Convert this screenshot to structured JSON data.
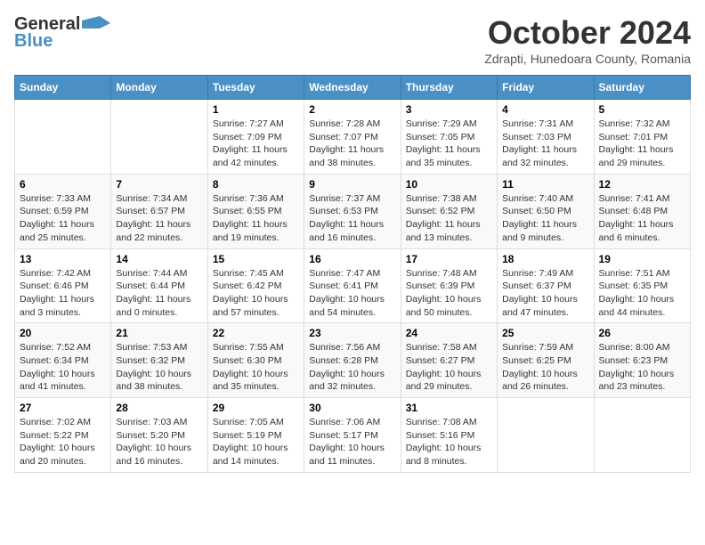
{
  "header": {
    "logo_general": "General",
    "logo_blue": "Blue",
    "month_title": "October 2024",
    "location": "Zdrapti, Hunedoara County, Romania"
  },
  "weekdays": [
    "Sunday",
    "Monday",
    "Tuesday",
    "Wednesday",
    "Thursday",
    "Friday",
    "Saturday"
  ],
  "weeks": [
    [
      {
        "day": "",
        "info": ""
      },
      {
        "day": "",
        "info": ""
      },
      {
        "day": "1",
        "info": "Sunrise: 7:27 AM\nSunset: 7:09 PM\nDaylight: 11 hours and 42 minutes."
      },
      {
        "day": "2",
        "info": "Sunrise: 7:28 AM\nSunset: 7:07 PM\nDaylight: 11 hours and 38 minutes."
      },
      {
        "day": "3",
        "info": "Sunrise: 7:29 AM\nSunset: 7:05 PM\nDaylight: 11 hours and 35 minutes."
      },
      {
        "day": "4",
        "info": "Sunrise: 7:31 AM\nSunset: 7:03 PM\nDaylight: 11 hours and 32 minutes."
      },
      {
        "day": "5",
        "info": "Sunrise: 7:32 AM\nSunset: 7:01 PM\nDaylight: 11 hours and 29 minutes."
      }
    ],
    [
      {
        "day": "6",
        "info": "Sunrise: 7:33 AM\nSunset: 6:59 PM\nDaylight: 11 hours and 25 minutes."
      },
      {
        "day": "7",
        "info": "Sunrise: 7:34 AM\nSunset: 6:57 PM\nDaylight: 11 hours and 22 minutes."
      },
      {
        "day": "8",
        "info": "Sunrise: 7:36 AM\nSunset: 6:55 PM\nDaylight: 11 hours and 19 minutes."
      },
      {
        "day": "9",
        "info": "Sunrise: 7:37 AM\nSunset: 6:53 PM\nDaylight: 11 hours and 16 minutes."
      },
      {
        "day": "10",
        "info": "Sunrise: 7:38 AM\nSunset: 6:52 PM\nDaylight: 11 hours and 13 minutes."
      },
      {
        "day": "11",
        "info": "Sunrise: 7:40 AM\nSunset: 6:50 PM\nDaylight: 11 hours and 9 minutes."
      },
      {
        "day": "12",
        "info": "Sunrise: 7:41 AM\nSunset: 6:48 PM\nDaylight: 11 hours and 6 minutes."
      }
    ],
    [
      {
        "day": "13",
        "info": "Sunrise: 7:42 AM\nSunset: 6:46 PM\nDaylight: 11 hours and 3 minutes."
      },
      {
        "day": "14",
        "info": "Sunrise: 7:44 AM\nSunset: 6:44 PM\nDaylight: 11 hours and 0 minutes."
      },
      {
        "day": "15",
        "info": "Sunrise: 7:45 AM\nSunset: 6:42 PM\nDaylight: 10 hours and 57 minutes."
      },
      {
        "day": "16",
        "info": "Sunrise: 7:47 AM\nSunset: 6:41 PM\nDaylight: 10 hours and 54 minutes."
      },
      {
        "day": "17",
        "info": "Sunrise: 7:48 AM\nSunset: 6:39 PM\nDaylight: 10 hours and 50 minutes."
      },
      {
        "day": "18",
        "info": "Sunrise: 7:49 AM\nSunset: 6:37 PM\nDaylight: 10 hours and 47 minutes."
      },
      {
        "day": "19",
        "info": "Sunrise: 7:51 AM\nSunset: 6:35 PM\nDaylight: 10 hours and 44 minutes."
      }
    ],
    [
      {
        "day": "20",
        "info": "Sunrise: 7:52 AM\nSunset: 6:34 PM\nDaylight: 10 hours and 41 minutes."
      },
      {
        "day": "21",
        "info": "Sunrise: 7:53 AM\nSunset: 6:32 PM\nDaylight: 10 hours and 38 minutes."
      },
      {
        "day": "22",
        "info": "Sunrise: 7:55 AM\nSunset: 6:30 PM\nDaylight: 10 hours and 35 minutes."
      },
      {
        "day": "23",
        "info": "Sunrise: 7:56 AM\nSunset: 6:28 PM\nDaylight: 10 hours and 32 minutes."
      },
      {
        "day": "24",
        "info": "Sunrise: 7:58 AM\nSunset: 6:27 PM\nDaylight: 10 hours and 29 minutes."
      },
      {
        "day": "25",
        "info": "Sunrise: 7:59 AM\nSunset: 6:25 PM\nDaylight: 10 hours and 26 minutes."
      },
      {
        "day": "26",
        "info": "Sunrise: 8:00 AM\nSunset: 6:23 PM\nDaylight: 10 hours and 23 minutes."
      }
    ],
    [
      {
        "day": "27",
        "info": "Sunrise: 7:02 AM\nSunset: 5:22 PM\nDaylight: 10 hours and 20 minutes."
      },
      {
        "day": "28",
        "info": "Sunrise: 7:03 AM\nSunset: 5:20 PM\nDaylight: 10 hours and 16 minutes."
      },
      {
        "day": "29",
        "info": "Sunrise: 7:05 AM\nSunset: 5:19 PM\nDaylight: 10 hours and 14 minutes."
      },
      {
        "day": "30",
        "info": "Sunrise: 7:06 AM\nSunset: 5:17 PM\nDaylight: 10 hours and 11 minutes."
      },
      {
        "day": "31",
        "info": "Sunrise: 7:08 AM\nSunset: 5:16 PM\nDaylight: 10 hours and 8 minutes."
      },
      {
        "day": "",
        "info": ""
      },
      {
        "day": "",
        "info": ""
      }
    ]
  ]
}
